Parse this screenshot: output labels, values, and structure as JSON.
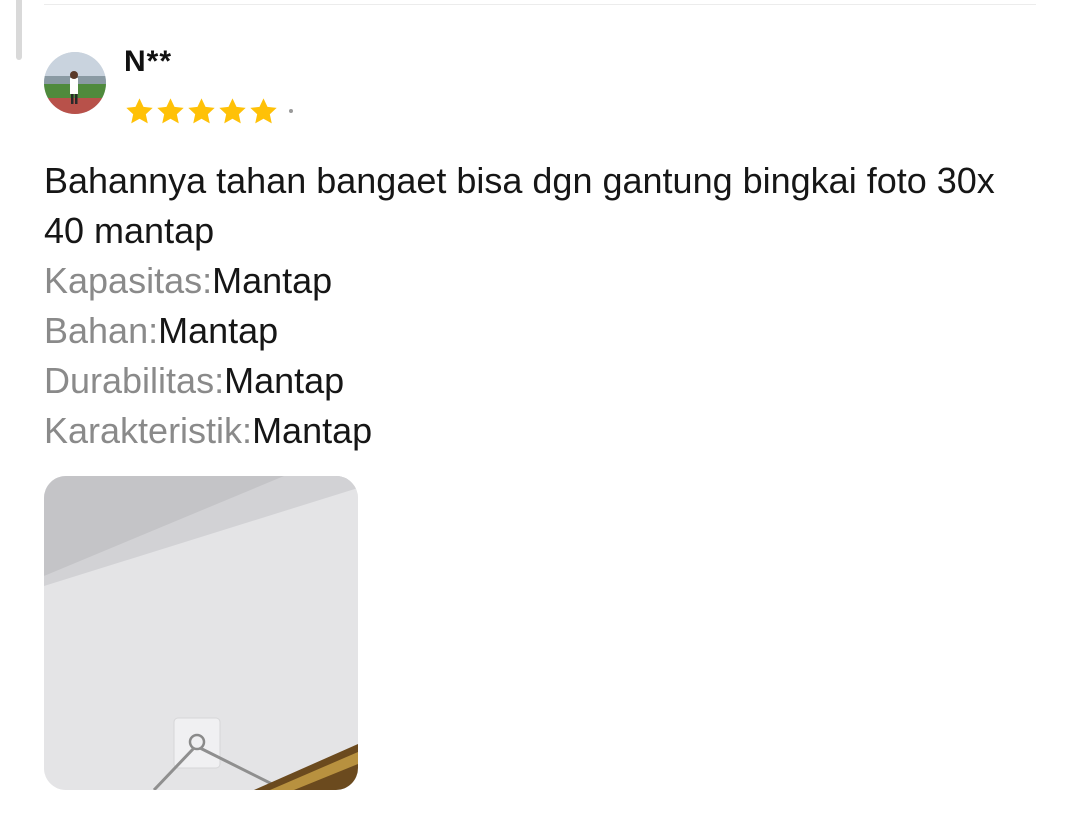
{
  "review": {
    "username": "N**",
    "rating": 5,
    "rating_max": 5,
    "star_color": "#FFC107",
    "text": "Bahannya tahan bangaet bisa dgn gantung bingkai foto 30x 40 mantap",
    "attributes": [
      {
        "label": "Kapasitas:",
        "value": "Mantap"
      },
      {
        "label": "Bahan:",
        "value": "Mantap"
      },
      {
        "label": "Durabilitas:",
        "value": "Mantap"
      },
      {
        "label": "Karakteristik:",
        "value": "Mantap"
      }
    ],
    "photo_count": 1
  },
  "icons": {
    "avatar": "user-avatar-photo",
    "star": "star-icon"
  }
}
